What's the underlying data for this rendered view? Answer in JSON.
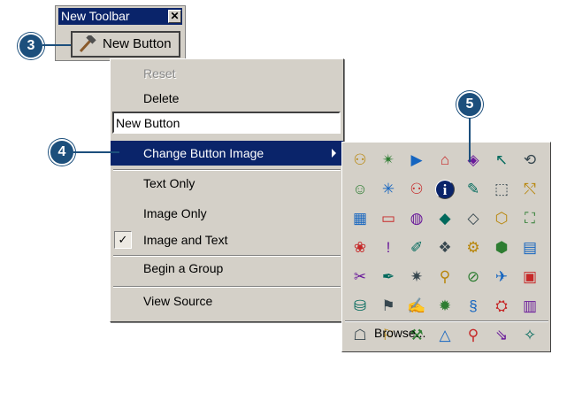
{
  "colors": {
    "title_bar": "#0a246a",
    "selection": "#0a246a",
    "face": "#d4d0c8",
    "callout": "#1c4f7c"
  },
  "toolbar": {
    "title": "New Toolbar",
    "close_glyph": "✕",
    "button_label": "New Button",
    "button_icon": "hammer-icon"
  },
  "callouts": {
    "c3": "3",
    "c4": "4",
    "c5": "5"
  },
  "menu": {
    "reset": "Reset",
    "delete": "Delete",
    "name_value": "New Button",
    "change_image": "Change Button Image",
    "text_only": "Text Only",
    "image_only": "Image Only",
    "image_and_text": "Image and Text",
    "image_and_text_checked": "✓",
    "begin_group": "Begin a Group",
    "view_source": "View Source"
  },
  "palette": {
    "icons": [
      [
        "⚇",
        "✴",
        "▶",
        "⌂",
        "◈",
        "↖",
        "⟲"
      ],
      [
        "☺",
        "✳",
        "⚇",
        "i",
        "✎",
        "⬚",
        "⤲"
      ],
      [
        "▦",
        "▭",
        "◍",
        "◆",
        "◇",
        "⬡",
        "⛶"
      ],
      [
        "❀",
        "!",
        "✐",
        "❖",
        "⚙",
        "⬢",
        "▤"
      ],
      [
        "✂",
        "✒",
        "✷",
        "⚲",
        "⊘",
        "✈",
        "▣"
      ],
      [
        "⛁",
        "⚑",
        "✍",
        "✹",
        "§",
        "⛭",
        "▥"
      ],
      [
        "☖",
        "⚐",
        "⚒",
        "△",
        "⚲",
        "⇘",
        "✧"
      ]
    ],
    "browse": "Browse..."
  }
}
